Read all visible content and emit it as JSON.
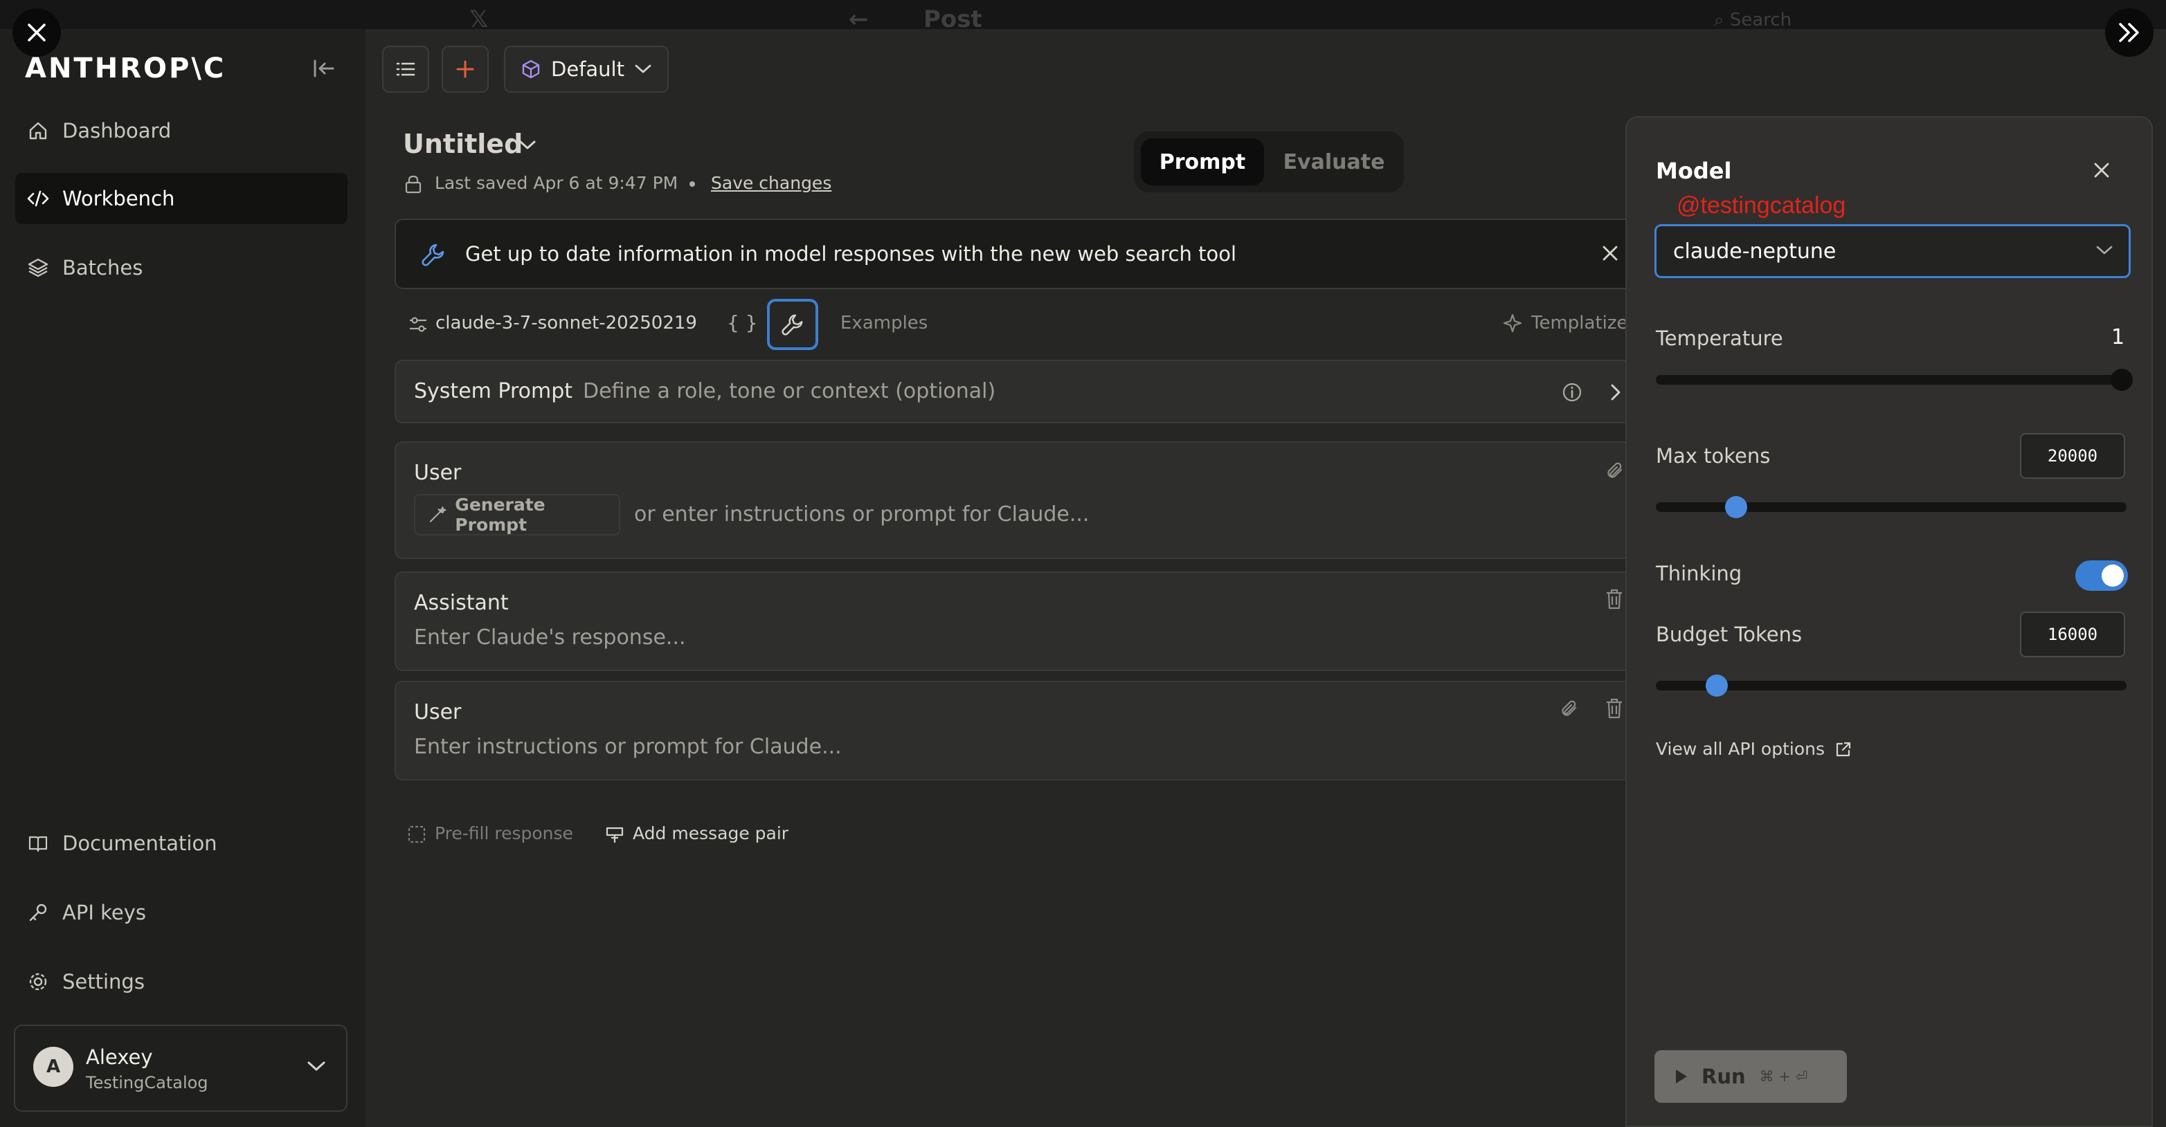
{
  "background_page": {
    "back_arrow": "←",
    "title": "Post",
    "search_placeholder": "Search"
  },
  "overlay": {
    "close_icon": "close-icon",
    "expand_icon": "double-chevron-right-icon"
  },
  "sidebar": {
    "logo": "ANTHROP\\C",
    "items": [
      {
        "label": "Dashboard",
        "icon": "home-icon",
        "active": false
      },
      {
        "label": "Workbench",
        "icon": "code-icon",
        "active": true
      },
      {
        "label": "Batches",
        "icon": "layers-icon",
        "active": false
      }
    ],
    "bottom_items": [
      {
        "label": "Documentation",
        "icon": "book-icon"
      },
      {
        "label": "API keys",
        "icon": "key-icon"
      },
      {
        "label": "Settings",
        "icon": "gear-icon"
      }
    ],
    "user": {
      "initial": "A",
      "name": "Alexey",
      "org": "TestingCatalog"
    }
  },
  "toolbar": {
    "preset_label": "Default"
  },
  "header": {
    "title": "Untitled",
    "last_saved": "Last saved Apr 6 at 9:47 PM",
    "save_changes": "Save changes",
    "tabs": [
      {
        "label": "Prompt",
        "active": true
      },
      {
        "label": "Evaluate",
        "active": false
      }
    ]
  },
  "banner": {
    "text": "Get up to date information in model responses with the new web search tool"
  },
  "model_row": {
    "model": "claude-3-7-sonnet-20250219",
    "braces": "{ }",
    "examples": "Examples",
    "templatize": "Templatize"
  },
  "system_prompt": {
    "label": "System Prompt",
    "placeholder": "Define a role, tone or context (optional)"
  },
  "messages": [
    {
      "role": "User",
      "generate_label": "Generate Prompt",
      "placeholder": "or enter instructions or prompt for Claude..."
    },
    {
      "role": "Assistant",
      "placeholder": "Enter Claude's response..."
    },
    {
      "role": "User",
      "placeholder": "Enter instructions or prompt for Claude..."
    }
  ],
  "actions": {
    "prefill": "Pre-fill response",
    "add_pair": "Add message pair"
  },
  "panel": {
    "title": "Model",
    "watermark": "@testingcatalog",
    "model_value": "claude-neptune",
    "temperature_label": "Temperature",
    "temperature_value": "1",
    "temperature_fraction": 1.0,
    "max_tokens_label": "Max tokens",
    "max_tokens_value": "20000",
    "max_tokens_fraction": 0.17,
    "thinking_label": "Thinking",
    "thinking_on": true,
    "budget_label": "Budget Tokens",
    "budget_value": "16000",
    "budget_fraction": 0.13,
    "api_link": "View all API options",
    "run_label": "Run",
    "run_shortcut": "⌘ + ⏎",
    "accent": "#3f82d6"
  }
}
